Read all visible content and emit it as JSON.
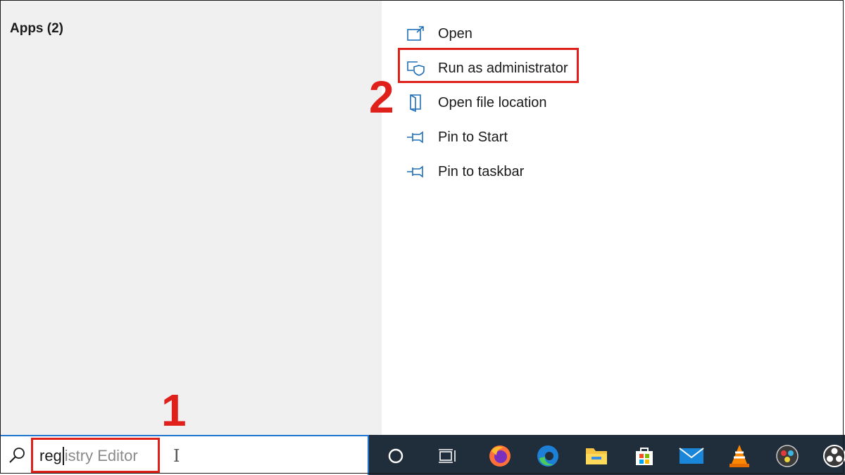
{
  "apps_section": {
    "header": "Apps (2)"
  },
  "context_menu": {
    "items": [
      {
        "label": "Open",
        "icon": "open-icon"
      },
      {
        "label": "Run as administrator",
        "icon": "run-as-admin-icon"
      },
      {
        "label": "Open file location",
        "icon": "file-location-icon"
      },
      {
        "label": "Pin to Start",
        "icon": "pin-icon"
      },
      {
        "label": "Pin to taskbar",
        "icon": "pin-icon"
      }
    ]
  },
  "annotations": {
    "step1": "1",
    "step2": "2",
    "color": "#e0201b"
  },
  "search": {
    "typed": "reg",
    "suggestion": "istry Editor",
    "cursor_glyph": "I"
  },
  "taskbar": {
    "background": "#202d3a",
    "icons": [
      "cortana-icon",
      "task-view-icon",
      "firefox-icon",
      "edge-icon",
      "file-explorer-icon",
      "microsoft-store-icon",
      "mail-icon",
      "vlc-icon",
      "davinci-resolve-icon",
      "obs-icon"
    ]
  }
}
